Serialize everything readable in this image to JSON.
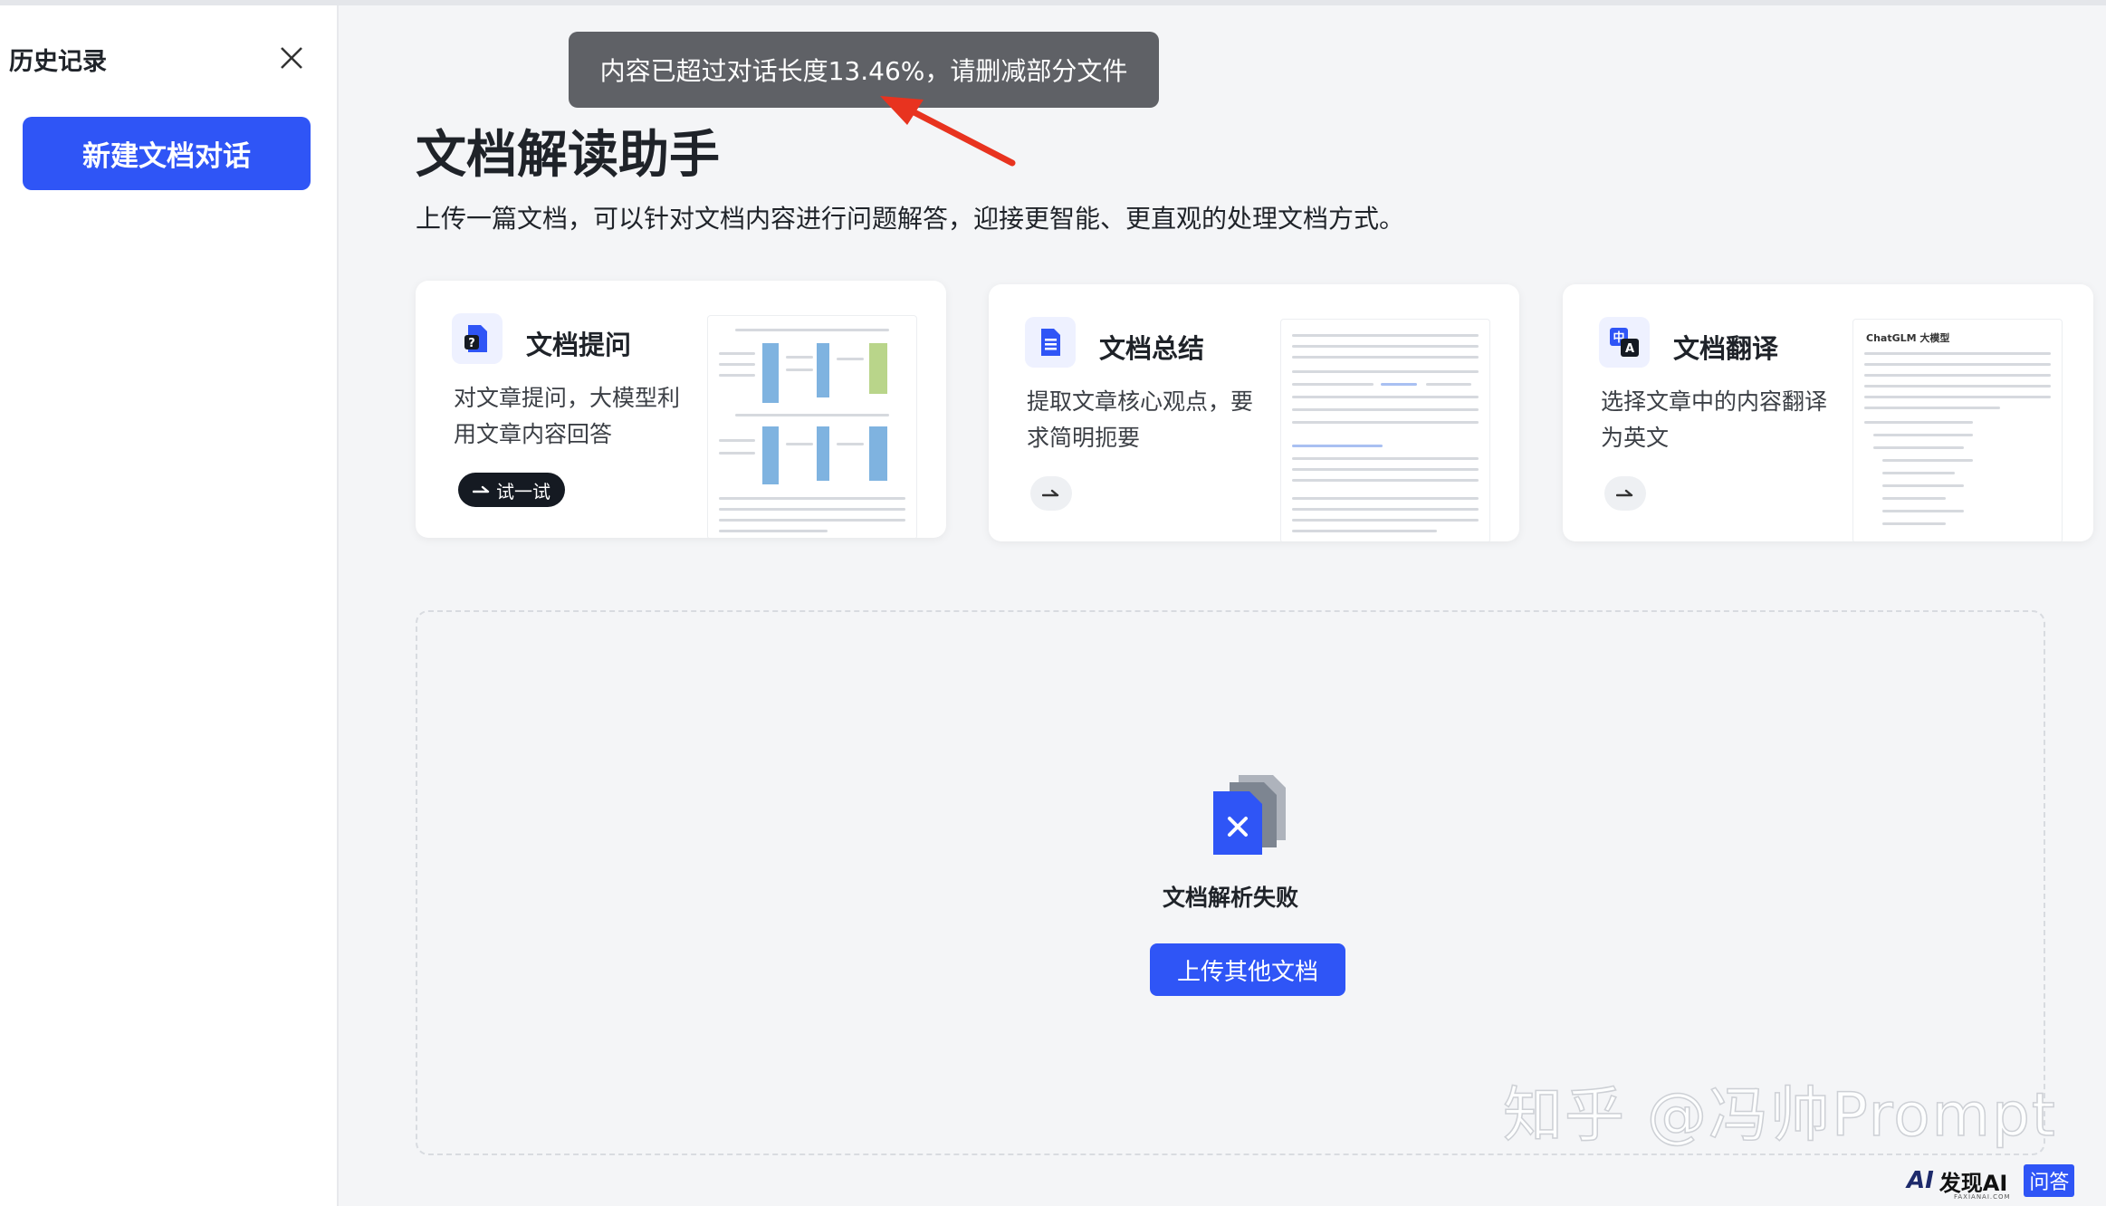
{
  "sidebar": {
    "title": "历史记录",
    "new_button": "新建文档对话"
  },
  "toast": {
    "message": "内容已超过对话长度13.46%，请删减部分文件"
  },
  "header": {
    "title": "文档解读助手",
    "subtitle": "上传一篇文档，可以针对文档内容进行问题解答，迎接更智能、更直观的处理文档方式。"
  },
  "cards": [
    {
      "title": "文档提问",
      "desc": "对文章提问，大模型利用文章内容回答",
      "action": "试一试",
      "icon": "question-doc-icon"
    },
    {
      "title": "文档总结",
      "desc": "提取文章核心观点，要求简明扼要",
      "icon": "summary-doc-icon"
    },
    {
      "title": "文档翻译",
      "desc": "选择文章中的内容翻译为英文",
      "icon": "translate-icon",
      "preview_heading": "ChatGLM 大模型"
    }
  ],
  "upload": {
    "status": "文档解析失败",
    "button": "上传其他文档"
  },
  "watermark": "知乎 @冯帅Prompt",
  "brand": {
    "logo": "AI",
    "name": "发现AI",
    "sub": "FAXIANAI.COM",
    "tag": "问答"
  },
  "colors": {
    "accent": "#2f55f6",
    "toast_bg": "#5f6166",
    "arrow": "#e8331f"
  }
}
